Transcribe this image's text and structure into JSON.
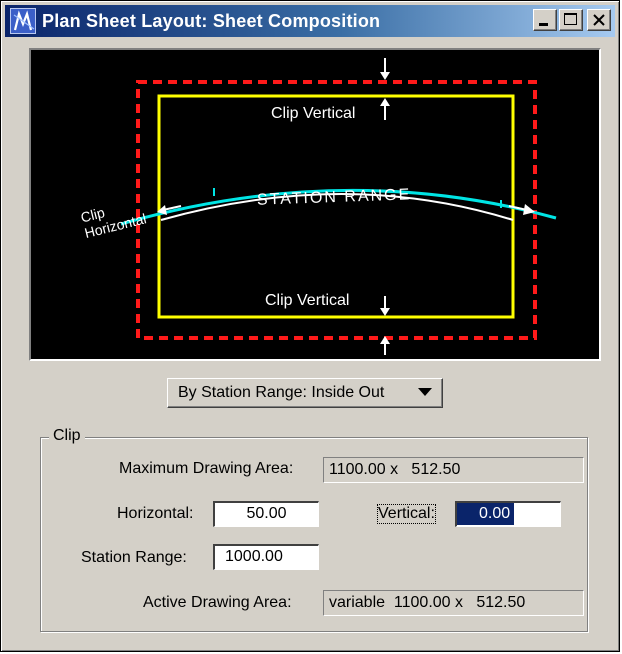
{
  "window": {
    "title": "Plan Sheet Layout: Sheet Composition"
  },
  "titlebar_buttons": {
    "minimize_icon": "minimize-icon",
    "maximize_icon": "maximize-icon",
    "close_icon": "close-icon"
  },
  "preview": {
    "clip_vertical_top": "Clip Vertical",
    "clip_vertical_bottom": "Clip Vertical",
    "clip_horizontal_line1": "Clip",
    "clip_horizontal_line2": "Horizontal",
    "station_range": "STATION RANGE",
    "colors": {
      "background": "#000000",
      "sheet_border": "#ff1a1a",
      "clip_box": "#ffff00",
      "alignment": "#00e5e5",
      "offset_line": "#ffffff",
      "annotation": "#ffffff"
    }
  },
  "mode_dropdown": {
    "selected": "By Station Range: Inside Out"
  },
  "clip": {
    "group_title": "Clip",
    "max_area_label": "Maximum Drawing Area:",
    "max_area_value": "1100.00 x   512.50",
    "horizontal_label": "Horizontal:",
    "horizontal_value": "50.00",
    "vertical_label": "Vertical:",
    "vertical_value": "0.00",
    "station_range_label": "Station Range:",
    "station_range_value": "1000.00",
    "active_area_label": "Active Drawing Area:",
    "active_area_value": "variable  1100.00 x   512.50"
  }
}
